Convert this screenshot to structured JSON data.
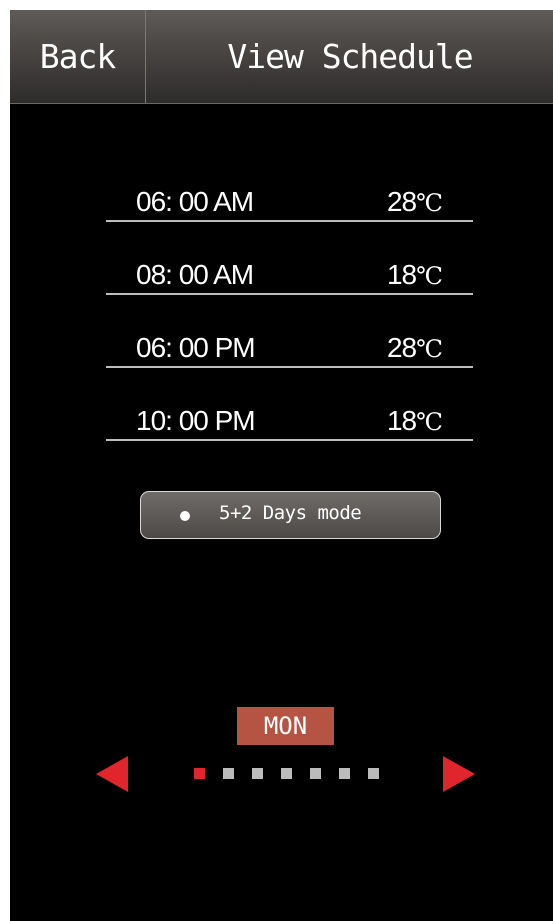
{
  "header": {
    "back_label": "Back",
    "title": "View Schedule"
  },
  "schedule": [
    {
      "time": "06: 00 AM",
      "temp_value": "28",
      "temp_unit": "℃"
    },
    {
      "time": "08: 00 AM",
      "temp_value": "18",
      "temp_unit": "℃"
    },
    {
      "time": "06: 00 PM",
      "temp_value": "28",
      "temp_unit": "℃"
    },
    {
      "time": "10: 00 PM",
      "temp_value": "18",
      "temp_unit": "℃"
    }
  ],
  "mode": {
    "label": "5+2 Days mode"
  },
  "day_selector": {
    "current_day": "MON",
    "total_days": 7,
    "active_index": 0
  },
  "colors": {
    "accent_red": "#e0262c",
    "day_badge": "#b55443",
    "inactive_dot": "#bcbcbc",
    "background": "#000000"
  }
}
